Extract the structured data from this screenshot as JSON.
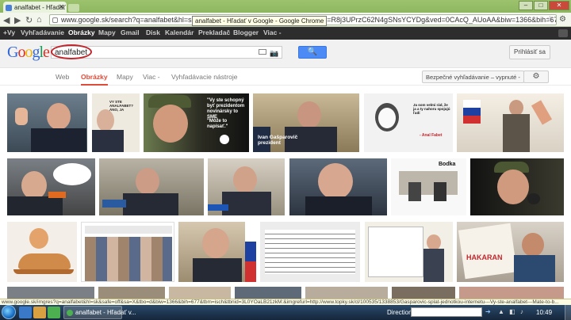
{
  "browser": {
    "tab_title": "analfabet - Hľadať v Goog",
    "url": "www.google.sk/search?q=analfabet&hl=sk&sa",
    "url_rest": "ch&sa=X&ei=R8j3UPrzC62N4gSNsYCYDg&ved=0CAcQ_AUoAA&biw=1366&bih=677",
    "tooltip": "analfabet - Hľadať v Google - Google Chrome"
  },
  "gbar": {
    "items": [
      "+Vy",
      "Vyhľadávanie",
      "Obrázky",
      "Mapy",
      "Gmail",
      "Disk",
      "Kalendár",
      "Prekladač",
      "Blogger",
      "Viac -"
    ]
  },
  "search": {
    "logo": "Google",
    "query": "analfabet",
    "signin": "Prihlásiť sa"
  },
  "tabs": {
    "items": [
      "Web",
      "Obrázky",
      "Mapy",
      "Viac -",
      "Vyhľadávacie nástroje"
    ],
    "safe_search": "Bezpečné vyhľadávanie – vypnuté -"
  },
  "thumbs": {
    "captions": {
      "t2": "VY STE ANALFABET? ÁNO, JA",
      "t3a": "\"Vy ste schopný",
      "t3b": "byť prezidentom",
      "t3c": "novinársky to SME",
      "t3d": "\"Môže to",
      "t3e": "napísať.\"",
      "t4": "Ivan Gašparovič prezident",
      "t5": "Ja som velmi rád, že ja a ty nahoru spojujú ľudí",
      "t5b": "- Anal Fabet",
      "t7": "Bodka",
      "t19": "HAKARAN"
    }
  },
  "statusbar": "www.google.sk/imgres?q=analfabet&hl=sk&safe=off&sa=X&tbo=d&biw=1366&bih=677&tbm=isch&tbnid=3L0YOaLB21zkM:&imgrefurl=http://www.topky.sk/cl/100535/1338853/Gasparovic-splat-jednotkou-internetu---Vy-ste-analfabet---Mate-to-b...",
  "taskbar": {
    "task": "analfabet - Hľadať v...",
    "address_label": "Direction",
    "clock": "10:49"
  }
}
